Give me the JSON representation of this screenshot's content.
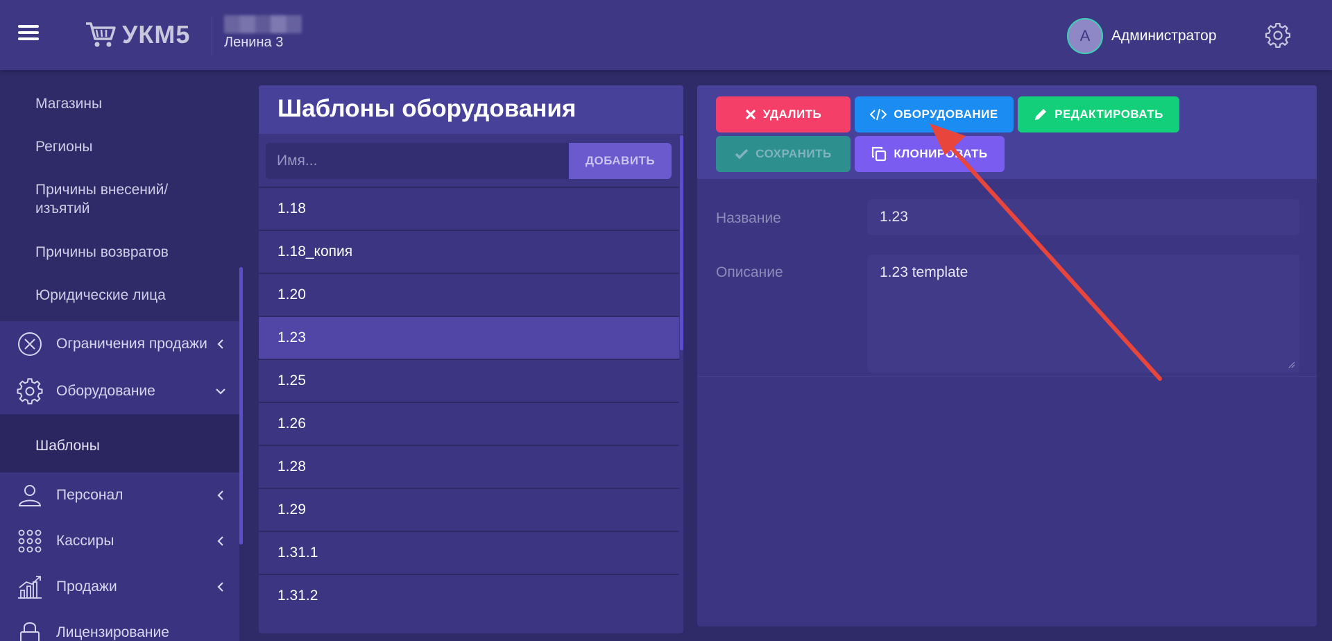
{
  "header": {
    "app_name": "УКМ5",
    "store_name": "Ленина 3",
    "user_initial": "А",
    "user_name": "Администратор"
  },
  "sidebar": {
    "sub_items": [
      {
        "label": "Магазины"
      },
      {
        "label": "Регионы"
      },
      {
        "label": "Причины внесений/ изъятий"
      },
      {
        "label": "Причины возвратов"
      },
      {
        "label": "Юридические лица"
      }
    ],
    "menu": [
      {
        "label": "Ограничения продажи",
        "icon": "circle-x-icon"
      },
      {
        "label": "Оборудование",
        "icon": "gear-icon",
        "expanded": true
      },
      {
        "label": "Персонал",
        "icon": "person-icon"
      },
      {
        "label": "Кассиры",
        "icon": "dots-grid-icon"
      },
      {
        "label": "Продажи",
        "icon": "chart-icon"
      },
      {
        "label": "Лицензирование",
        "icon": "lock-icon"
      }
    ],
    "active_sub_item": "Шаблоны"
  },
  "templates": {
    "title": "Шаблоны оборудования",
    "name_placeholder": "Имя...",
    "add_label": "ДОБАВИТЬ",
    "items": [
      "1.18",
      "1.18_копия",
      "1.20",
      "1.23",
      "1.25",
      "1.26",
      "1.28",
      "1.29",
      "1.31.1",
      "1.31.2"
    ],
    "selected": "1.23"
  },
  "detail": {
    "buttons": {
      "delete": "УДАЛИТЬ",
      "equipment": "ОБОРУДОВАНИЕ",
      "edit": "РЕДАКТИРОВАТЬ",
      "save": "СОХРАНИТЬ",
      "clone": "КЛОНИРОВАТЬ"
    },
    "name_label": "Название",
    "name_value": "1.23",
    "description_label": "Описание",
    "description_value": "1.23 template"
  },
  "colors": {
    "accent": "#6a5acd",
    "delete": "#f43f68",
    "equipment": "#1a8cf2",
    "edit": "#14cf7a",
    "clone": "#7a5cf0",
    "annotation_arrow": "#e8453c"
  }
}
